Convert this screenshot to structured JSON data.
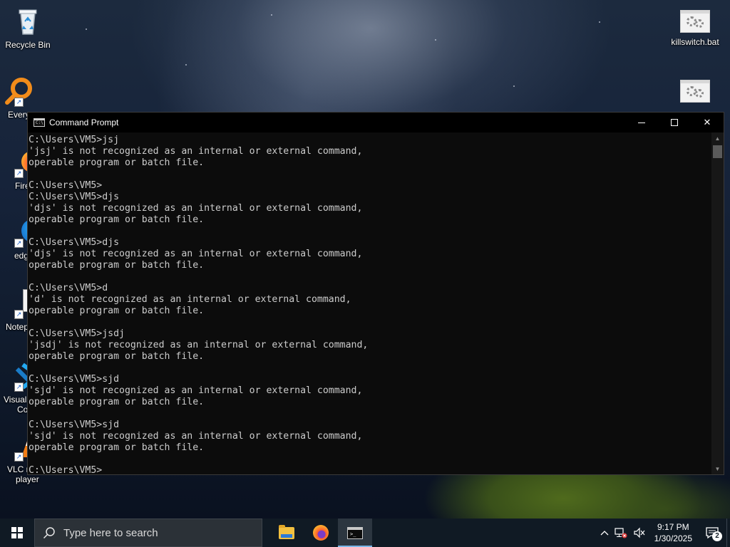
{
  "desktop": {
    "icons": [
      {
        "label": "Recycle Bin"
      },
      {
        "label": "Every"
      },
      {
        "label": "Fire"
      },
      {
        "label": "edg"
      },
      {
        "label": "Notep"
      },
      {
        "label": "Visual",
        "label2": "Co"
      },
      {
        "label": "VLC r",
        "label2": "player"
      },
      {
        "label": "killswitch.bat"
      },
      {
        "label": ""
      }
    ]
  },
  "window": {
    "title": "Command Prompt",
    "controls": {
      "minimize": "—",
      "maximize": "□",
      "close": "✕"
    }
  },
  "console": {
    "lines": [
      "C:\\Users\\VM5>jsj",
      "'jsj' is not recognized as an internal or external command,",
      "operable program or batch file.",
      "",
      "C:\\Users\\VM5>",
      "C:\\Users\\VM5>djs",
      "'djs' is not recognized as an internal or external command,",
      "operable program or batch file.",
      "",
      "C:\\Users\\VM5>djs",
      "'djs' is not recognized as an internal or external command,",
      "operable program or batch file.",
      "",
      "C:\\Users\\VM5>d",
      "'d' is not recognized as an internal or external command,",
      "operable program or batch file.",
      "",
      "C:\\Users\\VM5>jsdj",
      "'jsdj' is not recognized as an internal or external command,",
      "operable program or batch file.",
      "",
      "C:\\Users\\VM5>sjd",
      "'sjd' is not recognized as an internal or external command,",
      "operable program or batch file.",
      "",
      "C:\\Users\\VM5>sjd",
      "'sjd' is not recognized as an internal or external command,",
      "operable program or batch file.",
      ""
    ],
    "prompt": "C:\\Users\\VM5>"
  },
  "taskbar": {
    "search_placeholder": "Type here to search",
    "apps": [
      {
        "name": "File Explorer",
        "icon": "folder-icon"
      },
      {
        "name": "Firefox",
        "icon": "firefox-icon"
      },
      {
        "name": "Command Prompt",
        "icon": "cmd-icon",
        "active": true
      }
    ],
    "tray": {
      "chevron": "^",
      "time": "9:17 PM",
      "date": "1/30/2025",
      "notification_count": "2"
    }
  },
  "colors": {
    "console_bg": "#0c0c0c",
    "console_text": "#cccccc",
    "taskbar_bg": "#101a24",
    "active_accent": "#7ab7e8"
  }
}
